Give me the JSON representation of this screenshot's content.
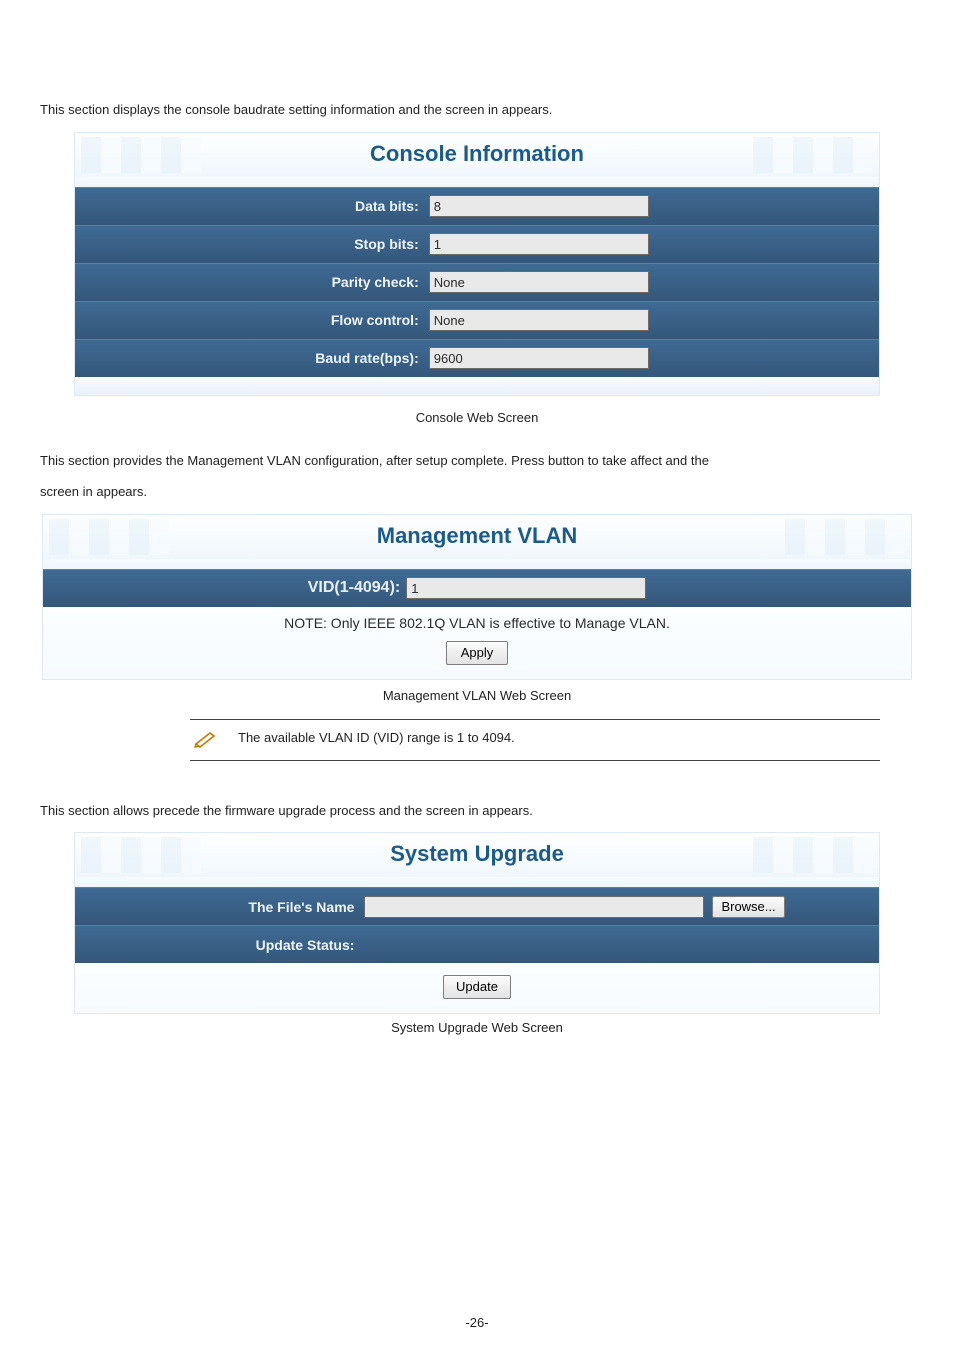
{
  "section1": {
    "intro_pre": "This section displays the console baudrate setting information and the screen in ",
    "intro_post": " appears."
  },
  "console": {
    "title": "Console Information",
    "rows": {
      "data_bits": {
        "label": "Data bits:",
        "value": "8"
      },
      "stop_bits": {
        "label": "Stop bits:",
        "value": "1"
      },
      "parity": {
        "label": "Parity check:",
        "value": "None"
      },
      "flow": {
        "label": "Flow control:",
        "value": "None"
      },
      "baud": {
        "label": "Baud rate(bps):",
        "value": "9600"
      }
    },
    "caption": "Console Web Screen"
  },
  "section2": {
    "intro_pre": "This section provides the Management VLAN configuration, after setup complete. Press ",
    "intro_mid": " button to take affect and the",
    "intro_line2_pre": "screen in ",
    "intro_line2_post": " appears."
  },
  "mgmt": {
    "title": "Management VLAN",
    "vid_label": "VID(1-4094):",
    "vid_value": "1",
    "note": "NOTE: Only IEEE 802.1Q VLAN is effective to Manage VLAN.",
    "apply": "Apply",
    "caption": "Management VLAN Web Screen",
    "tip": "The available VLAN ID (VID) range is 1 to 4094."
  },
  "section3": {
    "intro_pre": "This section allows precede the firmware upgrade process and the screen in ",
    "intro_post": " appears."
  },
  "sys": {
    "title": "System Upgrade",
    "file_label": "The File's Name",
    "browse": "Browse...",
    "status_label": "Update Status:",
    "update": "Update",
    "caption": "System Upgrade Web Screen"
  },
  "page": "-26-"
}
